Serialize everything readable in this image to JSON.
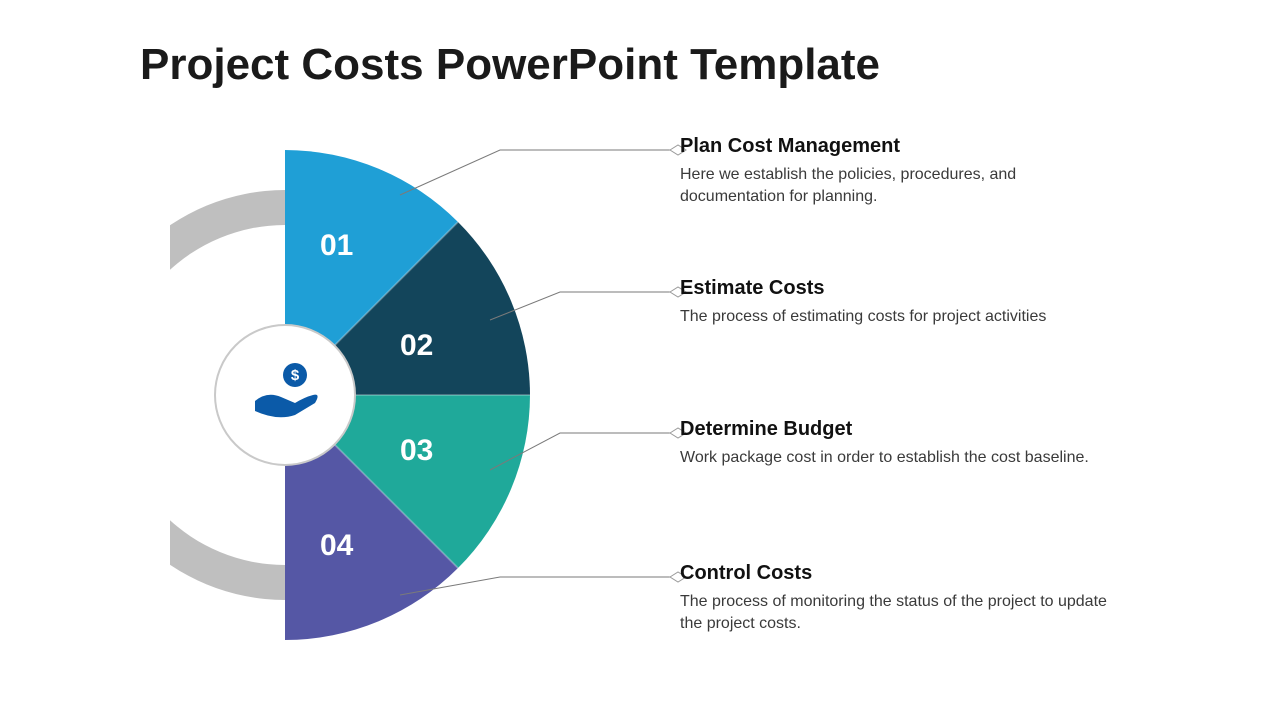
{
  "title": "Project Costs PowerPoint Template",
  "segments": [
    {
      "num": "01",
      "heading": "Plan Cost Management",
      "body": "Here we establish the policies, procedures, and documentation for planning.",
      "color": "#1f9fd6",
      "colorDark": "#1686b8"
    },
    {
      "num": "02",
      "heading": "Estimate Costs",
      "body": "The process of estimating costs for project activities",
      "color": "#13455b",
      "colorDark": "#0d3546"
    },
    {
      "num": "03",
      "heading": "Determine Budget",
      "body": "Work package cost in order to establish the cost baseline.",
      "color": "#1fa99a",
      "colorDark": "#188b7f"
    },
    {
      "num": "04",
      "heading": "Control Costs",
      "body": "The process of monitoring the status of the project to update the project costs.",
      "color": "#5557a5",
      "colorDark": "#45478a"
    }
  ],
  "centerIcon": "money-hand-icon",
  "ringColor": "#bfbfbf"
}
